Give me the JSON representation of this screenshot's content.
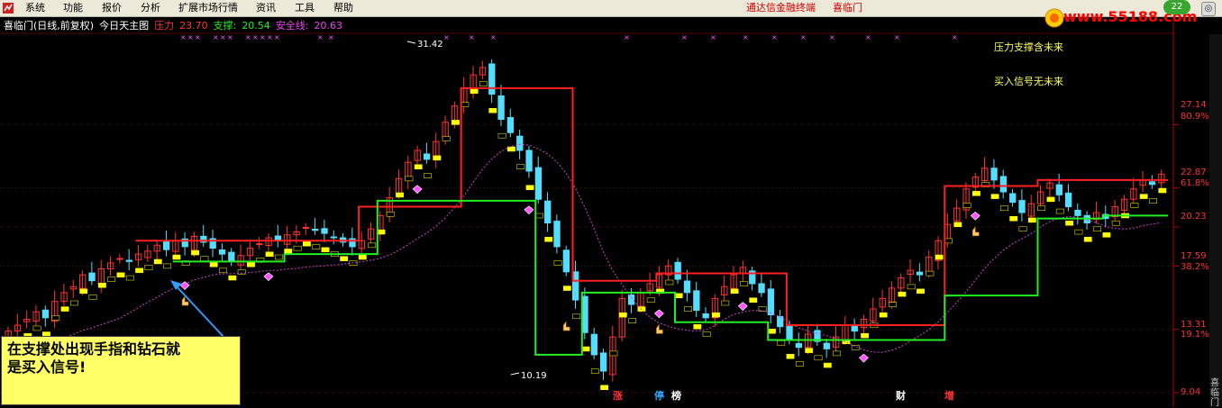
{
  "menu": {
    "items": [
      "系统",
      "功能",
      "报价",
      "分析",
      "扩展市场行情",
      "资讯",
      "工具",
      "帮助"
    ],
    "center_text": [
      "通达信金融终端",
      "喜临门"
    ]
  },
  "watermark": {
    "text": "www.55188.com",
    "badge": "22",
    "close": "◎"
  },
  "chart_header": {
    "stock": "喜临门(日线,前复权)",
    "indicator": "今日天主图",
    "pressure_label": "压力",
    "pressure_value": "23.70",
    "support_label": "支撑:",
    "support_value": "20.54",
    "safety_label": "安全线:",
    "safety_value": "20.63"
  },
  "notes": {
    "line1": "压力支撑含未来",
    "line2": "买入信号无未来"
  },
  "annotations": {
    "high": "31.42",
    "low": "10.19"
  },
  "callout": {
    "line1": "在支撑处出现手指和钻石就",
    "line2": "是买入信号!"
  },
  "bottom_tags": [
    {
      "text": "涨",
      "color": "#ff3333"
    },
    {
      "text": "停",
      "color": "#33aaff"
    },
    {
      "text": "榜",
      "color": "#ffffff"
    },
    {
      "text": "财",
      "color": "#ffffff"
    },
    {
      "text": "增",
      "color": "#ff3333"
    }
  ],
  "side_text": "喜临门",
  "colors": {
    "up": "#ff3333",
    "down": "#55ddff",
    "pressure": "#ff2020",
    "support": "#22ee22",
    "safety": "#cc44cc",
    "stair": "#ffff00",
    "axis": "#b00000",
    "marker": "#ff55ff"
  },
  "chart_data": {
    "type": "line",
    "title": "喜临门(日线,前复权)",
    "y_axis": {
      "ticks": [
        27.14,
        22.87,
        20.23,
        17.59,
        13.31,
        9.04
      ],
      "pct_ticks": [
        "80.9%",
        "61.8%",
        "38.2%",
        "19.1%"
      ],
      "range": [
        9.04,
        31.42
      ]
    },
    "high": 31.42,
    "low": 10.19,
    "last": {
      "pressure": 23.7,
      "support": 20.54,
      "safety": 20.63
    },
    "candles_close": [
      13.2,
      13.6,
      14.0,
      14.5,
      14.1,
      15.2,
      15.8,
      16.2,
      17.0,
      16.6,
      17.4,
      17.8,
      18.1,
      17.9,
      18.4,
      18.6,
      19.0,
      18.7,
      19.3,
      18.9,
      19.6,
      19.2,
      18.8,
      18.4,
      17.9,
      18.3,
      18.8,
      19.1,
      19.5,
      19.3,
      19.7,
      19.9,
      20.2,
      20.0,
      19.8,
      19.5,
      19.2,
      18.9,
      19.3,
      20.1,
      21.0,
      22.2,
      23.5,
      24.6,
      25.4,
      24.8,
      26.0,
      27.3,
      28.4,
      29.6,
      30.5,
      31.0,
      29.2,
      27.5,
      26.6,
      25.4,
      24.0,
      22.1,
      20.5,
      18.9,
      17.2,
      15.3,
      13.1,
      11.6,
      10.5,
      12.8,
      15.4,
      15.0,
      15.8,
      16.4,
      17.0,
      17.6,
      16.7,
      15.8,
      14.6,
      14.1,
      15.4,
      16.2,
      17.0,
      17.5,
      16.4,
      15.8,
      14.3,
      13.5,
      12.6,
      12.1,
      13.0,
      12.5,
      12.0,
      12.8,
      13.6,
      13.2,
      14.0,
      14.7,
      15.4,
      16.1,
      16.8,
      17.3,
      17.0,
      18.2,
      19.3,
      20.4,
      21.5,
      22.8,
      23.6,
      24.2,
      23.4,
      22.6,
      21.9,
      21.2,
      21.8,
      22.6,
      23.2,
      22.4,
      21.6,
      21.0,
      20.5,
      21.2,
      20.8,
      21.6,
      22.1,
      22.8,
      23.4,
      23.1,
      23.8
    ]
  }
}
